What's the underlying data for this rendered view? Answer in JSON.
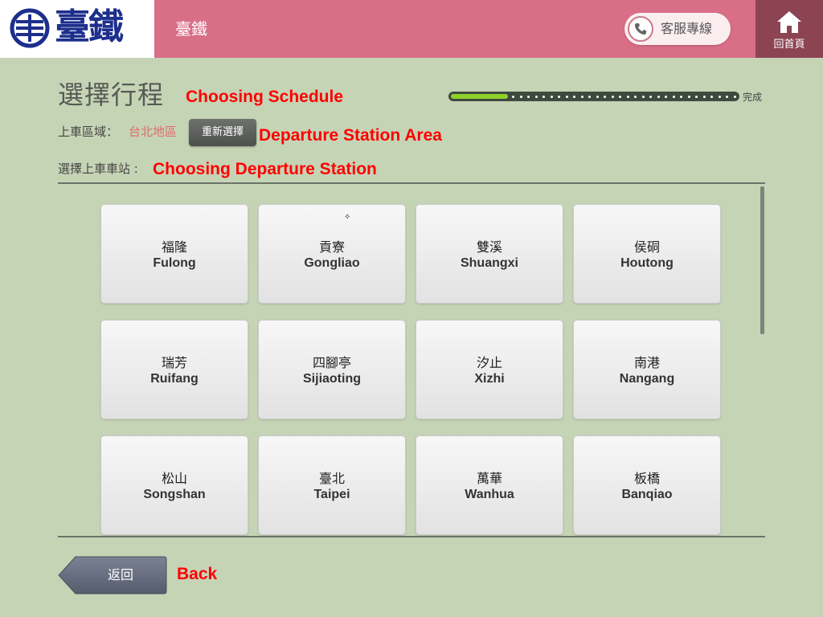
{
  "header": {
    "logo_text": "臺鐵",
    "title": "臺鐵",
    "hotline_label": "客服專線",
    "home_label": "回首頁"
  },
  "page": {
    "title": "選擇行程",
    "title_annotation": "Choosing Schedule",
    "progress_done_label": "完成",
    "progress_fraction": 0.2
  },
  "area": {
    "label": "上車區域：",
    "value": "台北地區",
    "reselect_label": "重新選擇",
    "annotation": "Departure Station Area"
  },
  "station_prompt": {
    "label": "選擇上車車站 :",
    "annotation": "Choosing Departure Station"
  },
  "stations": [
    {
      "cn": "福隆",
      "en": "Fulong"
    },
    {
      "cn": "貢寮",
      "en": "Gongliao"
    },
    {
      "cn": "雙溪",
      "en": "Shuangxi"
    },
    {
      "cn": "侯硐",
      "en": "Houtong"
    },
    {
      "cn": "瑞芳",
      "en": "Ruifang"
    },
    {
      "cn": "四腳亭",
      "en": "Sijiaoting"
    },
    {
      "cn": "汐止",
      "en": "Xizhi"
    },
    {
      "cn": "南港",
      "en": "Nangang"
    },
    {
      "cn": "松山",
      "en": "Songshan"
    },
    {
      "cn": "臺北",
      "en": "Taipei"
    },
    {
      "cn": "萬華",
      "en": "Wanhua"
    },
    {
      "cn": "板橋",
      "en": "Banqiao"
    }
  ],
  "back": {
    "label": "返回",
    "annotation": "Back"
  },
  "colors": {
    "background": "#c6d4b6",
    "header": "#d96e87",
    "home": "#8c4453",
    "logo": "#1d2f8c",
    "annotation": "#ff0000",
    "progress": "#8ed22a"
  }
}
